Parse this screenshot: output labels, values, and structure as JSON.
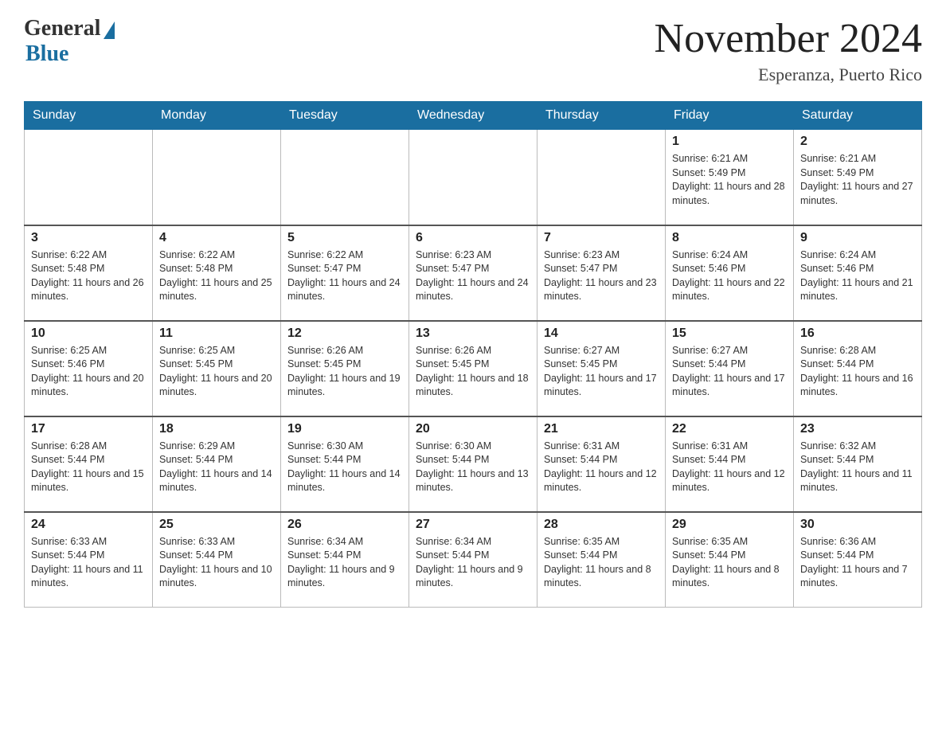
{
  "header": {
    "logo_general": "General",
    "logo_blue": "Blue",
    "month_title": "November 2024",
    "location": "Esperanza, Puerto Rico"
  },
  "weekdays": [
    "Sunday",
    "Monday",
    "Tuesday",
    "Wednesday",
    "Thursday",
    "Friday",
    "Saturday"
  ],
  "weeks": [
    [
      {
        "day": "",
        "sunrise": "",
        "sunset": "",
        "daylight": ""
      },
      {
        "day": "",
        "sunrise": "",
        "sunset": "",
        "daylight": ""
      },
      {
        "day": "",
        "sunrise": "",
        "sunset": "",
        "daylight": ""
      },
      {
        "day": "",
        "sunrise": "",
        "sunset": "",
        "daylight": ""
      },
      {
        "day": "",
        "sunrise": "",
        "sunset": "",
        "daylight": ""
      },
      {
        "day": "1",
        "sunrise": "Sunrise: 6:21 AM",
        "sunset": "Sunset: 5:49 PM",
        "daylight": "Daylight: 11 hours and 28 minutes."
      },
      {
        "day": "2",
        "sunrise": "Sunrise: 6:21 AM",
        "sunset": "Sunset: 5:49 PM",
        "daylight": "Daylight: 11 hours and 27 minutes."
      }
    ],
    [
      {
        "day": "3",
        "sunrise": "Sunrise: 6:22 AM",
        "sunset": "Sunset: 5:48 PM",
        "daylight": "Daylight: 11 hours and 26 minutes."
      },
      {
        "day": "4",
        "sunrise": "Sunrise: 6:22 AM",
        "sunset": "Sunset: 5:48 PM",
        "daylight": "Daylight: 11 hours and 25 minutes."
      },
      {
        "day": "5",
        "sunrise": "Sunrise: 6:22 AM",
        "sunset": "Sunset: 5:47 PM",
        "daylight": "Daylight: 11 hours and 24 minutes."
      },
      {
        "day": "6",
        "sunrise": "Sunrise: 6:23 AM",
        "sunset": "Sunset: 5:47 PM",
        "daylight": "Daylight: 11 hours and 24 minutes."
      },
      {
        "day": "7",
        "sunrise": "Sunrise: 6:23 AM",
        "sunset": "Sunset: 5:47 PM",
        "daylight": "Daylight: 11 hours and 23 minutes."
      },
      {
        "day": "8",
        "sunrise": "Sunrise: 6:24 AM",
        "sunset": "Sunset: 5:46 PM",
        "daylight": "Daylight: 11 hours and 22 minutes."
      },
      {
        "day": "9",
        "sunrise": "Sunrise: 6:24 AM",
        "sunset": "Sunset: 5:46 PM",
        "daylight": "Daylight: 11 hours and 21 minutes."
      }
    ],
    [
      {
        "day": "10",
        "sunrise": "Sunrise: 6:25 AM",
        "sunset": "Sunset: 5:46 PM",
        "daylight": "Daylight: 11 hours and 20 minutes."
      },
      {
        "day": "11",
        "sunrise": "Sunrise: 6:25 AM",
        "sunset": "Sunset: 5:45 PM",
        "daylight": "Daylight: 11 hours and 20 minutes."
      },
      {
        "day": "12",
        "sunrise": "Sunrise: 6:26 AM",
        "sunset": "Sunset: 5:45 PM",
        "daylight": "Daylight: 11 hours and 19 minutes."
      },
      {
        "day": "13",
        "sunrise": "Sunrise: 6:26 AM",
        "sunset": "Sunset: 5:45 PM",
        "daylight": "Daylight: 11 hours and 18 minutes."
      },
      {
        "day": "14",
        "sunrise": "Sunrise: 6:27 AM",
        "sunset": "Sunset: 5:45 PM",
        "daylight": "Daylight: 11 hours and 17 minutes."
      },
      {
        "day": "15",
        "sunrise": "Sunrise: 6:27 AM",
        "sunset": "Sunset: 5:44 PM",
        "daylight": "Daylight: 11 hours and 17 minutes."
      },
      {
        "day": "16",
        "sunrise": "Sunrise: 6:28 AM",
        "sunset": "Sunset: 5:44 PM",
        "daylight": "Daylight: 11 hours and 16 minutes."
      }
    ],
    [
      {
        "day": "17",
        "sunrise": "Sunrise: 6:28 AM",
        "sunset": "Sunset: 5:44 PM",
        "daylight": "Daylight: 11 hours and 15 minutes."
      },
      {
        "day": "18",
        "sunrise": "Sunrise: 6:29 AM",
        "sunset": "Sunset: 5:44 PM",
        "daylight": "Daylight: 11 hours and 14 minutes."
      },
      {
        "day": "19",
        "sunrise": "Sunrise: 6:30 AM",
        "sunset": "Sunset: 5:44 PM",
        "daylight": "Daylight: 11 hours and 14 minutes."
      },
      {
        "day": "20",
        "sunrise": "Sunrise: 6:30 AM",
        "sunset": "Sunset: 5:44 PM",
        "daylight": "Daylight: 11 hours and 13 minutes."
      },
      {
        "day": "21",
        "sunrise": "Sunrise: 6:31 AM",
        "sunset": "Sunset: 5:44 PM",
        "daylight": "Daylight: 11 hours and 12 minutes."
      },
      {
        "day": "22",
        "sunrise": "Sunrise: 6:31 AM",
        "sunset": "Sunset: 5:44 PM",
        "daylight": "Daylight: 11 hours and 12 minutes."
      },
      {
        "day": "23",
        "sunrise": "Sunrise: 6:32 AM",
        "sunset": "Sunset: 5:44 PM",
        "daylight": "Daylight: 11 hours and 11 minutes."
      }
    ],
    [
      {
        "day": "24",
        "sunrise": "Sunrise: 6:33 AM",
        "sunset": "Sunset: 5:44 PM",
        "daylight": "Daylight: 11 hours and 11 minutes."
      },
      {
        "day": "25",
        "sunrise": "Sunrise: 6:33 AM",
        "sunset": "Sunset: 5:44 PM",
        "daylight": "Daylight: 11 hours and 10 minutes."
      },
      {
        "day": "26",
        "sunrise": "Sunrise: 6:34 AM",
        "sunset": "Sunset: 5:44 PM",
        "daylight": "Daylight: 11 hours and 9 minutes."
      },
      {
        "day": "27",
        "sunrise": "Sunrise: 6:34 AM",
        "sunset": "Sunset: 5:44 PM",
        "daylight": "Daylight: 11 hours and 9 minutes."
      },
      {
        "day": "28",
        "sunrise": "Sunrise: 6:35 AM",
        "sunset": "Sunset: 5:44 PM",
        "daylight": "Daylight: 11 hours and 8 minutes."
      },
      {
        "day": "29",
        "sunrise": "Sunrise: 6:35 AM",
        "sunset": "Sunset: 5:44 PM",
        "daylight": "Daylight: 11 hours and 8 minutes."
      },
      {
        "day": "30",
        "sunrise": "Sunrise: 6:36 AM",
        "sunset": "Sunset: 5:44 PM",
        "daylight": "Daylight: 11 hours and 7 minutes."
      }
    ]
  ]
}
